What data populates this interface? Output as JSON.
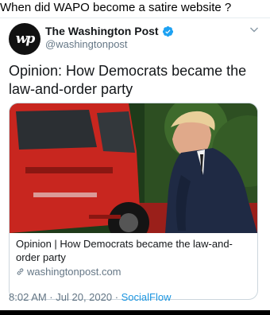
{
  "caption": "When did WAPO become a satire website ?",
  "tweet": {
    "author_name": "The Washington Post",
    "author_handle": "@washingtonpost",
    "avatar_text": "wp",
    "text": "Opinion: How Democrats became the law-and-order party",
    "link_card": {
      "title": "Opinion | How Democrats became the law-and-order party",
      "domain": "washingtonpost.com"
    },
    "timestamp": "8:02 AM · Jul 20, 2020 · ",
    "source": "SocialFlow"
  },
  "colors": {
    "verified": "#1da1f2",
    "secondary_text": "#657786",
    "link_blue": "#1b95e0",
    "truck_red": "#c8261f",
    "suit_navy": "#1f2a44"
  },
  "icons": [
    "verified-badge-icon",
    "chevron-down-icon",
    "link-icon"
  ]
}
